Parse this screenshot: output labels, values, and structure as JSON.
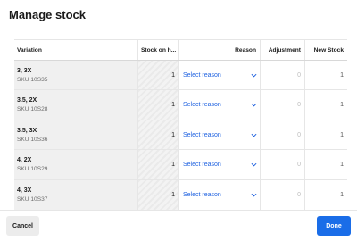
{
  "modal": {
    "title": "Manage stock"
  },
  "table": {
    "headers": {
      "variation": "Variation",
      "stock": "Stock on h...",
      "reason": "Reason",
      "adjustment": "Adjustment",
      "new_stock": "New Stock"
    },
    "rows": [
      {
        "name": "3, 3X",
        "sku": "SKU 10S35",
        "stock": "1",
        "reason": "Select reason",
        "adjustment": "0",
        "new_stock": "1"
      },
      {
        "name": "3.5, 2X",
        "sku": "SKU 10S28",
        "stock": "1",
        "reason": "Select reason",
        "adjustment": "0",
        "new_stock": "1"
      },
      {
        "name": "3.5, 3X",
        "sku": "SKU 10S36",
        "stock": "1",
        "reason": "Select reason",
        "adjustment": "0",
        "new_stock": "1"
      },
      {
        "name": "4, 2X",
        "sku": "SKU 10S29",
        "stock": "1",
        "reason": "Select reason",
        "adjustment": "0",
        "new_stock": "1"
      },
      {
        "name": "4, 3X",
        "sku": "SKU 10S37",
        "stock": "1",
        "reason": "Select reason",
        "adjustment": "0",
        "new_stock": "1"
      }
    ]
  },
  "footer": {
    "cancel_label": "Cancel",
    "done_label": "Done"
  },
  "colors": {
    "accent": "#1a6de8",
    "link": "#1f62e0"
  }
}
